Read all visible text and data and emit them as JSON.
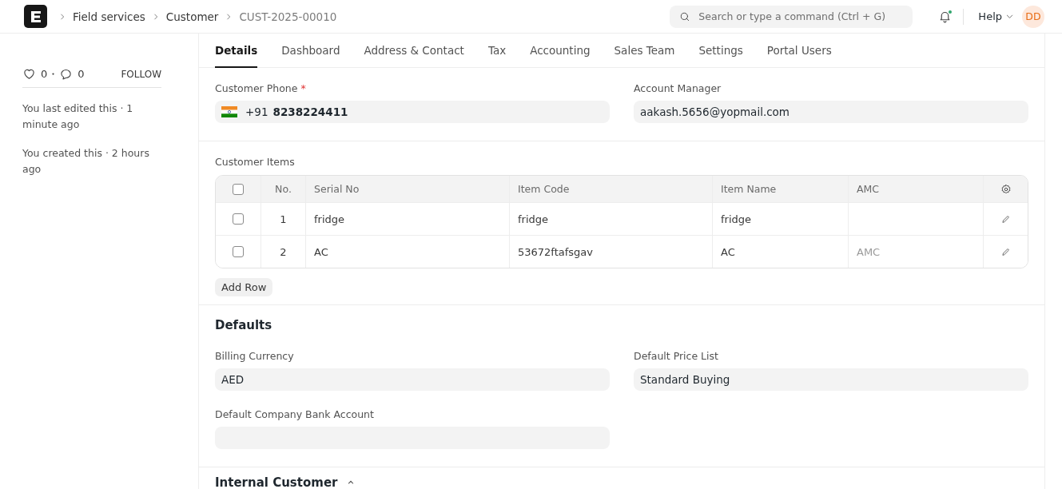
{
  "breadcrumbs": [
    "Field services",
    "Customer",
    "CUST-2025-00010"
  ],
  "search": {
    "placeholder": "Search or type a command (Ctrl + G)"
  },
  "notifications": {
    "unread": true
  },
  "help": "Help",
  "avatar": "DD",
  "sidebar": {
    "likes": "0",
    "comments": "0",
    "follow": "FOLLOW",
    "activity": [
      "You last edited this · 1 minute ago",
      "You created this · 2 hours ago"
    ]
  },
  "tabs": [
    {
      "label": "Details",
      "selected": true
    },
    {
      "label": "Dashboard",
      "selected": false
    },
    {
      "label": "Address & Contact",
      "selected": false
    },
    {
      "label": "Tax",
      "selected": false
    },
    {
      "label": "Accounting",
      "selected": false
    },
    {
      "label": "Sales Team",
      "selected": false
    },
    {
      "label": "Settings",
      "selected": false
    },
    {
      "label": "Portal Users",
      "selected": false
    }
  ],
  "contact": {
    "phone": {
      "label": "Customer Phone",
      "required": true,
      "required_mark": "*",
      "prefix": "+91",
      "number": "8238224411"
    },
    "account_manager": {
      "label": "Account Manager",
      "value": "aakash.5656@yopmail.com"
    }
  },
  "customer_items": {
    "label": "Customer Items",
    "all_checked": false,
    "columns": [
      "No.",
      "Serial No",
      "Item Code",
      "Item Name",
      "AMC"
    ],
    "rows": [
      {
        "checked": false,
        "no": "1",
        "serial_no": "fridge",
        "item_code": "fridge",
        "item_name": "fridge"
      },
      {
        "checked": false,
        "no": "2",
        "serial_no": "AC",
        "item_code": "53672ftafsgav",
        "item_name": "AC",
        "amc_placeholder": "AMC"
      }
    ],
    "add_row": "Add Row"
  },
  "defaults": {
    "title": "Defaults",
    "fields": [
      {
        "label": "Billing Currency",
        "value": "AED"
      },
      {
        "label": "Default Price List",
        "value": "Standard Buying"
      },
      {
        "label": "Default Company Bank Account"
      }
    ]
  },
  "next_section": {
    "title": "Internal Customer",
    "expanded": true
  }
}
